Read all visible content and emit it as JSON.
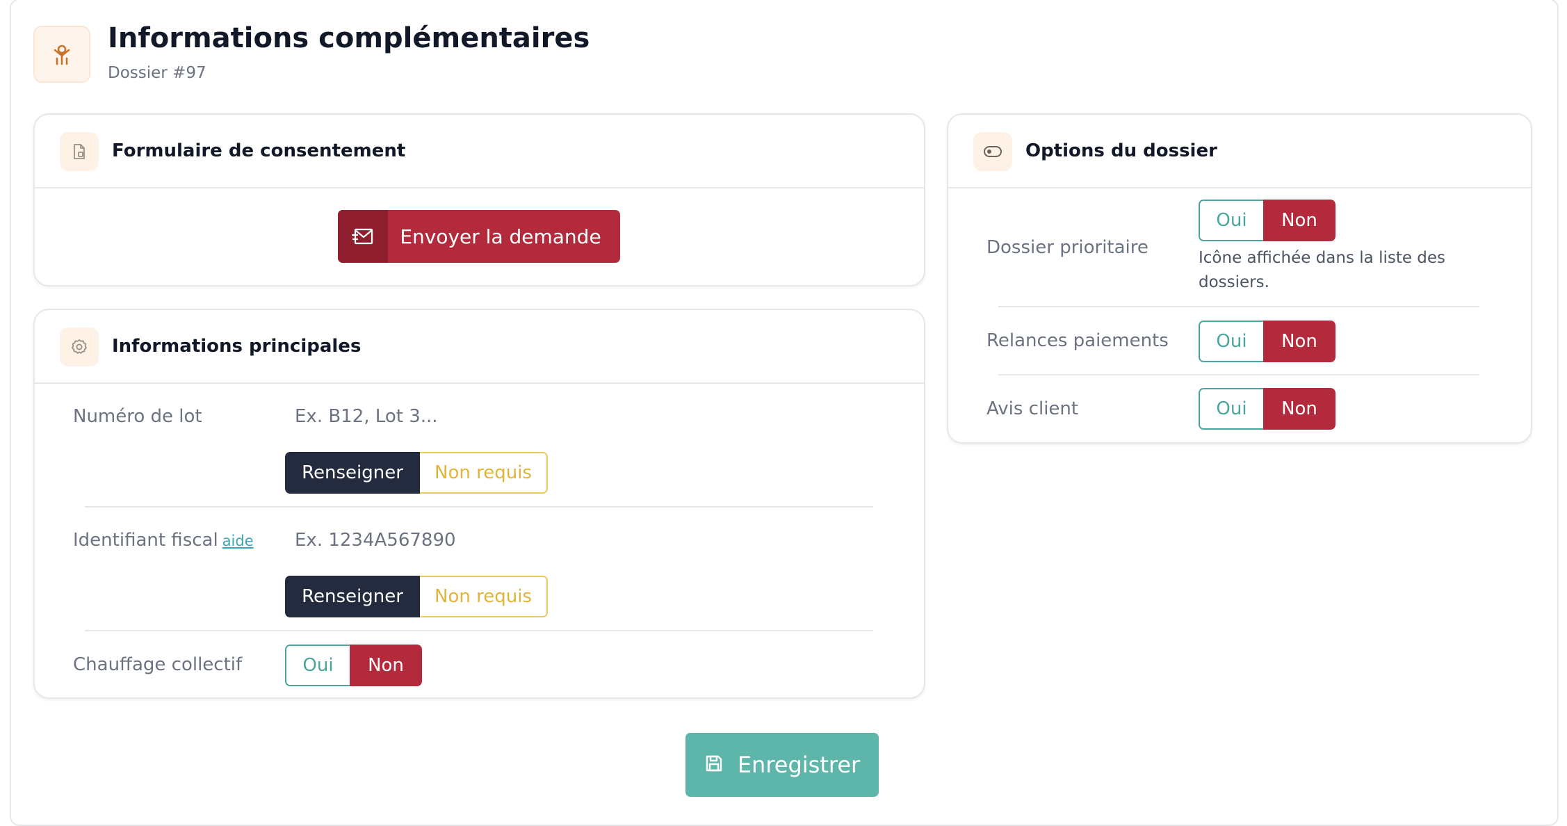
{
  "header": {
    "title": "Informations complémentaires",
    "subtitle": "Dossier #97",
    "icon": "person-arms-icon"
  },
  "colors": {
    "accent_red": "#b32a3c",
    "accent_teal": "#5eb5aa",
    "dark_navy": "#242b3e",
    "yellow_outline": "#edc95e"
  },
  "consent_card": {
    "title": "Formulaire de consentement",
    "send_button": "Envoyer la demande"
  },
  "main_card": {
    "title": "Informations principales",
    "lot": {
      "label": "Numéro de lot",
      "placeholder": "Ex. B12, Lot 3...",
      "fill_label": "Renseigner",
      "not_required_label": "Non requis"
    },
    "fiscal": {
      "label": "Identifiant fiscal",
      "help_link": "aide",
      "placeholder": "Ex. 1234A567890",
      "fill_label": "Renseigner",
      "not_required_label": "Non requis"
    },
    "heating": {
      "label": "Chauffage collectif",
      "yes": "Oui",
      "no": "Non",
      "selected": "Non"
    }
  },
  "options_card": {
    "title": "Options du dossier",
    "priority": {
      "label": "Dossier prioritaire",
      "yes": "Oui",
      "no": "Non",
      "selected": "Non",
      "hint": "Icône affichée dans la liste des dossiers."
    },
    "payment_reminders": {
      "label": "Relances paiements",
      "yes": "Oui",
      "no": "Non",
      "selected": "Non"
    },
    "client_review": {
      "label": "Avis client",
      "yes": "Oui",
      "no": "Non",
      "selected": "Non"
    }
  },
  "save_button": "Enregistrer"
}
